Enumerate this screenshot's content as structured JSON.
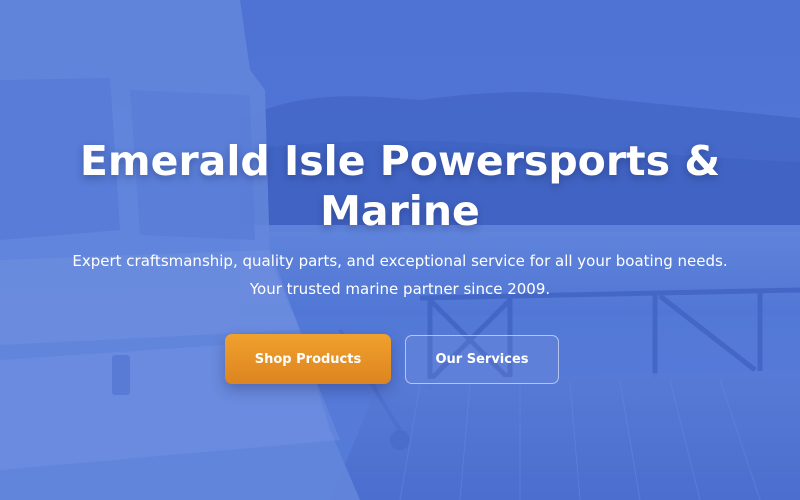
{
  "hero": {
    "title": "Emerald Isle Powersports & Marine",
    "subtitle_line1": "Expert craftsmanship, quality parts, and exceptional service for all your boating needs.",
    "subtitle_line2": "Your trusted marine partner since 2009.",
    "primary_button_label": "Shop Products",
    "secondary_button_label": "Our Services"
  },
  "colors": {
    "overlay": "#4a6fd0",
    "primary_button": "#e8922a",
    "text": "#ffffff"
  }
}
